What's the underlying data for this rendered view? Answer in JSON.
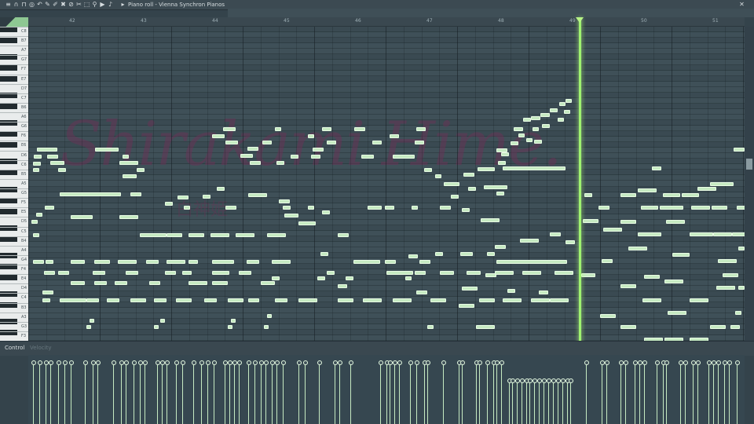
{
  "window": {
    "title": "Piano roll - Vienna Synchron Pianos",
    "title_arrow": "›",
    "toolbar_icons": [
      "menu-icon",
      "magnet-icon",
      "stamp-icon",
      "target-icon",
      "undo-icon",
      "pencil-icon",
      "brush-icon",
      "delete-icon",
      "mute-icon",
      "slice-icon",
      "select-icon",
      "zoom-icon",
      "playback-icon",
      "speaker-icon"
    ],
    "close_glyph": "✕",
    "arrow_glyph": "▸"
  },
  "ruler": {
    "bars": [
      "42",
      "43",
      "44",
      "45",
      "46",
      "47",
      "48",
      "49",
      "50",
      "51"
    ]
  },
  "keyboard": {
    "labels": [
      "C8",
      "B7",
      "A7",
      "G7",
      "F7",
      "E7",
      "D7",
      "C7",
      "B6",
      "A6",
      "G6",
      "F6",
      "E6",
      "D6",
      "C6",
      "B5",
      "A5",
      "G5",
      "F5",
      "E5",
      "D5",
      "C5",
      "B4",
      "A4",
      "G4",
      "F4",
      "E4",
      "D4",
      "C4",
      "B3",
      "A3",
      "G3",
      "F3"
    ]
  },
  "watermark": {
    "text": "Shirakami Hime.",
    "sub": "白神姫"
  },
  "control": {
    "label": "Control",
    "separator": "›",
    "target": "Velocity"
  },
  "colors": {
    "note": "#c6eac2",
    "playhead": "#9ff270",
    "grid": "#3f5058"
  },
  "notes": [
    [
      47,
      188,
      26
    ],
    [
      43,
      197,
      10
    ],
    [
      42,
      206,
      10
    ],
    [
      42,
      214,
      8
    ],
    [
      60,
      197,
      14
    ],
    [
      64,
      205,
      18
    ],
    [
      74,
      214,
      10
    ],
    [
      121,
      188,
      30
    ],
    [
      156,
      197,
      8
    ],
    [
      152,
      205,
      24
    ],
    [
      156,
      222,
      18
    ],
    [
      174,
      214,
      10
    ],
    [
      40,
      280,
      8
    ],
    [
      46,
      271,
      8
    ],
    [
      57,
      262,
      12
    ],
    [
      76,
      245,
      78
    ],
    [
      90,
      274,
      28
    ],
    [
      152,
      274,
      24
    ],
    [
      166,
      245,
      14
    ],
    [
      210,
      257,
      10
    ],
    [
      234,
      262,
      8
    ],
    [
      226,
      249,
      14
    ],
    [
      258,
      248,
      10
    ],
    [
      276,
      238,
      10
    ],
    [
      287,
      262,
      14
    ],
    [
      316,
      246,
      24
    ],
    [
      360,
      262,
      10
    ],
    [
      355,
      254,
      14
    ],
    [
      362,
      272,
      18
    ],
    [
      392,
      262,
      8
    ],
    [
      410,
      268,
      10
    ],
    [
      284,
      162,
      16
    ],
    [
      270,
      171,
      16
    ],
    [
      287,
      179,
      16
    ],
    [
      315,
      187,
      14
    ],
    [
      306,
      196,
      16
    ],
    [
      318,
      205,
      14
    ],
    [
      350,
      162,
      8
    ],
    [
      334,
      179,
      12
    ],
    [
      352,
      205,
      10
    ],
    [
      370,
      197,
      10
    ],
    [
      396,
      197,
      12
    ],
    [
      398,
      188,
      14
    ],
    [
      416,
      179,
      12
    ],
    [
      392,
      171,
      8
    ],
    [
      410,
      162,
      12
    ],
    [
      460,
      197,
      16
    ],
    [
      474,
      179,
      12
    ],
    [
      451,
      162,
      14
    ],
    [
      496,
      171,
      12
    ],
    [
      500,
      197,
      28
    ],
    [
      530,
      162,
      12
    ],
    [
      528,
      179,
      12
    ],
    [
      540,
      214,
      10
    ],
    [
      554,
      222,
      8
    ],
    [
      42,
      297,
      8
    ],
    [
      178,
      297,
      34
    ],
    [
      212,
      297,
      20
    ],
    [
      240,
      297,
      20
    ],
    [
      268,
      297,
      24
    ],
    [
      300,
      297,
      24
    ],
    [
      340,
      297,
      24
    ],
    [
      380,
      282,
      22
    ],
    [
      430,
      297,
      14
    ],
    [
      468,
      262,
      18
    ],
    [
      490,
      262,
      12
    ],
    [
      524,
      262,
      8
    ],
    [
      560,
      262,
      14
    ],
    [
      574,
      248,
      10
    ],
    [
      565,
      232,
      20
    ],
    [
      596,
      238,
      10
    ],
    [
      608,
      213,
      22
    ],
    [
      590,
      220,
      14
    ],
    [
      634,
      205,
      10
    ],
    [
      632,
      189,
      14
    ],
    [
      638,
      194,
      10
    ],
    [
      650,
      180,
      10
    ],
    [
      660,
      170,
      8
    ],
    [
      654,
      162,
      12
    ],
    [
      666,
      150,
      10
    ],
    [
      676,
      148,
      12
    ],
    [
      688,
      144,
      12
    ],
    [
      700,
      138,
      10
    ],
    [
      712,
      130,
      8
    ],
    [
      720,
      126,
      8
    ],
    [
      718,
      140,
      8
    ],
    [
      710,
      150,
      8
    ],
    [
      690,
      158,
      10
    ],
    [
      678,
      162,
      8
    ],
    [
      670,
      176,
      8
    ],
    [
      680,
      178,
      10
    ],
    [
      640,
      212,
      80
    ],
    [
      616,
      236,
      30
    ],
    [
      632,
      244,
      10
    ],
    [
      612,
      278,
      24
    ],
    [
      588,
      265,
      10
    ],
    [
      42,
      331,
      14
    ],
    [
      58,
      331,
      10
    ],
    [
      90,
      331,
      18
    ],
    [
      120,
      331,
      20
    ],
    [
      150,
      331,
      24
    ],
    [
      186,
      331,
      16
    ],
    [
      212,
      331,
      24
    ],
    [
      240,
      331,
      12
    ],
    [
      270,
      331,
      28
    ],
    [
      314,
      331,
      16
    ],
    [
      346,
      331,
      24
    ],
    [
      408,
      321,
      10
    ],
    [
      450,
      331,
      34
    ],
    [
      490,
      331,
      14
    ],
    [
      520,
      324,
      12
    ],
    [
      534,
      331,
      14
    ],
    [
      554,
      321,
      10
    ],
    [
      586,
      321,
      16
    ],
    [
      620,
      321,
      10
    ],
    [
      632,
      331,
      90
    ],
    [
      618,
      348,
      14
    ],
    [
      630,
      312,
      14
    ],
    [
      662,
      304,
      24
    ],
    [
      700,
      296,
      14
    ],
    [
      720,
      306,
      12
    ],
    [
      56,
      345,
      14
    ],
    [
      74,
      345,
      14
    ],
    [
      118,
      345,
      16
    ],
    [
      160,
      345,
      16
    ],
    [
      210,
      345,
      14
    ],
    [
      232,
      345,
      12
    ],
    [
      270,
      345,
      22
    ],
    [
      304,
      345,
      16
    ],
    [
      346,
      352,
      10
    ],
    [
      416,
      345,
      10
    ],
    [
      430,
      362,
      12
    ],
    [
      492,
      345,
      34
    ],
    [
      528,
      345,
      14
    ],
    [
      560,
      345,
      18
    ],
    [
      594,
      345,
      18
    ],
    [
      630,
      345,
      24
    ],
    [
      665,
      345,
      24
    ],
    [
      706,
      345,
      24
    ],
    [
      90,
      358,
      18
    ],
    [
      120,
      358,
      16
    ],
    [
      146,
      358,
      16
    ],
    [
      190,
      358,
      14
    ],
    [
      240,
      358,
      24
    ],
    [
      270,
      358,
      20
    ],
    [
      332,
      358,
      18
    ],
    [
      404,
      352,
      10
    ],
    [
      440,
      352,
      10
    ],
    [
      516,
      352,
      8
    ],
    [
      588,
      365,
      20
    ],
    [
      646,
      368,
      10
    ],
    [
      686,
      370,
      12
    ],
    [
      54,
      370,
      14
    ],
    [
      76,
      380,
      34
    ],
    [
      110,
      380,
      16
    ],
    [
      136,
      380,
      16
    ],
    [
      166,
      380,
      20
    ],
    [
      196,
      380,
      16
    ],
    [
      224,
      380,
      20
    ],
    [
      260,
      380,
      16
    ],
    [
      290,
      380,
      20
    ],
    [
      316,
      380,
      14
    ],
    [
      350,
      380,
      16
    ],
    [
      380,
      380,
      24
    ],
    [
      430,
      380,
      20
    ],
    [
      462,
      380,
      24
    ],
    [
      500,
      380,
      24
    ],
    [
      530,
      370,
      14
    ],
    [
      548,
      380,
      20
    ],
    [
      584,
      387,
      20
    ],
    [
      610,
      380,
      20
    ],
    [
      640,
      380,
      24
    ],
    [
      676,
      380,
      24
    ],
    [
      700,
      380,
      24
    ],
    [
      54,
      380,
      10
    ],
    [
      114,
      406,
      6
    ],
    [
      110,
      414,
      6
    ],
    [
      204,
      406,
      6
    ],
    [
      196,
      414,
      6
    ],
    [
      294,
      406,
      6
    ],
    [
      290,
      414,
      6
    ],
    [
      340,
      400,
      6
    ],
    [
      336,
      414,
      6
    ],
    [
      544,
      414,
      8
    ],
    [
      606,
      414,
      24
    ],
    [
      744,
      246,
      10
    ],
    [
      742,
      279,
      20
    ],
    [
      740,
      348,
      18
    ],
    [
      762,
      262,
      14
    ],
    [
      768,
      290,
      24
    ],
    [
      764,
      400,
      20
    ],
    [
      766,
      330,
      14
    ],
    [
      790,
      246,
      20
    ],
    [
      790,
      280,
      20
    ],
    [
      790,
      362,
      20
    ],
    [
      800,
      314,
      24
    ],
    [
      790,
      414,
      20
    ],
    [
      812,
      240,
      24
    ],
    [
      816,
      262,
      22
    ],
    [
      812,
      296,
      30
    ],
    [
      820,
      350,
      20
    ],
    [
      818,
      380,
      24
    ],
    [
      830,
      212,
      12
    ],
    [
      840,
      262,
      30
    ],
    [
      844,
      246,
      22
    ],
    [
      848,
      280,
      24
    ],
    [
      856,
      322,
      22
    ],
    [
      846,
      356,
      24
    ],
    [
      850,
      396,
      24
    ],
    [
      868,
      246,
      22
    ],
    [
      878,
      296,
      30
    ],
    [
      880,
      262,
      24
    ],
    [
      878,
      380,
      24
    ],
    [
      888,
      238,
      24
    ],
    [
      904,
      232,
      30
    ],
    [
      906,
      262,
      20
    ],
    [
      908,
      296,
      24
    ],
    [
      912,
      364,
      24
    ],
    [
      914,
      330,
      24
    ],
    [
      920,
      348,
      20
    ],
    [
      932,
      296,
      18
    ],
    [
      934,
      188,
      14
    ],
    [
      938,
      262,
      12
    ],
    [
      940,
      314,
      8
    ],
    [
      940,
      364,
      8
    ],
    [
      936,
      396,
      8
    ],
    [
      820,
      430,
      24
    ],
    [
      846,
      430,
      24
    ],
    [
      878,
      430,
      24
    ],
    [
      930,
      414,
      12
    ],
    [
      904,
      414,
      20
    ]
  ],
  "velocities": [
    [
      40,
      78
    ],
    [
      48,
      78
    ],
    [
      56,
      78
    ],
    [
      62,
      78
    ],
    [
      72,
      78
    ],
    [
      80,
      78
    ],
    [
      88,
      78
    ],
    [
      106,
      78
    ],
    [
      116,
      78
    ],
    [
      122,
      78
    ],
    [
      142,
      78
    ],
    [
      152,
      78
    ],
    [
      158,
      78
    ],
    [
      168,
      78
    ],
    [
      176,
      78
    ],
    [
      182,
      78
    ],
    [
      198,
      78
    ],
    [
      204,
      78
    ],
    [
      210,
      78
    ],
    [
      222,
      78
    ],
    [
      230,
      78
    ],
    [
      244,
      78
    ],
    [
      254,
      78
    ],
    [
      262,
      78
    ],
    [
      270,
      78
    ],
    [
      284,
      78
    ],
    [
      290,
      78
    ],
    [
      296,
      78
    ],
    [
      302,
      78
    ],
    [
      314,
      78
    ],
    [
      322,
      78
    ],
    [
      330,
      78
    ],
    [
      336,
      78
    ],
    [
      344,
      78
    ],
    [
      350,
      78
    ],
    [
      358,
      78
    ],
    [
      378,
      78
    ],
    [
      386,
      78
    ],
    [
      404,
      78
    ],
    [
      424,
      78
    ],
    [
      430,
      78
    ],
    [
      444,
      78
    ],
    [
      482,
      78
    ],
    [
      490,
      78
    ],
    [
      494,
      78
    ],
    [
      500,
      78
    ],
    [
      506,
      78
    ],
    [
      520,
      78
    ],
    [
      528,
      78
    ],
    [
      538,
      78
    ],
    [
      542,
      78
    ],
    [
      562,
      78
    ],
    [
      582,
      78
    ],
    [
      586,
      78
    ],
    [
      604,
      78
    ],
    [
      608,
      78
    ],
    [
      618,
      78
    ],
    [
      626,
      78
    ],
    [
      630,
      78
    ],
    [
      636,
      78
    ],
    [
      646,
      55
    ],
    [
      650,
      55
    ],
    [
      656,
      55
    ],
    [
      662,
      55
    ],
    [
      668,
      55
    ],
    [
      672,
      55
    ],
    [
      678,
      55
    ],
    [
      684,
      55
    ],
    [
      690,
      55
    ],
    [
      696,
      55
    ],
    [
      702,
      55
    ],
    [
      708,
      55
    ],
    [
      714,
      55
    ],
    [
      720,
      55
    ],
    [
      724,
      55
    ],
    [
      744,
      78
    ],
    [
      764,
      78
    ],
    [
      770,
      78
    ],
    [
      788,
      78
    ],
    [
      794,
      78
    ],
    [
      806,
      78
    ],
    [
      812,
      78
    ],
    [
      818,
      78
    ],
    [
      834,
      78
    ],
    [
      842,
      78
    ],
    [
      846,
      78
    ],
    [
      864,
      78
    ],
    [
      870,
      78
    ],
    [
      880,
      78
    ],
    [
      886,
      78
    ],
    [
      900,
      78
    ],
    [
      906,
      78
    ],
    [
      912,
      78
    ],
    [
      920,
      78
    ],
    [
      926,
      78
    ],
    [
      936,
      78
    ]
  ]
}
